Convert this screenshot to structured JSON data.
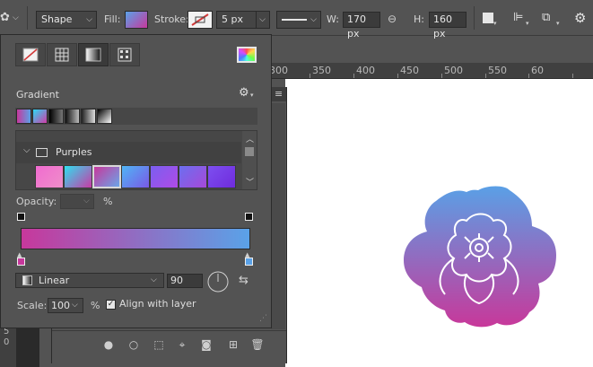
{
  "options_bar": {
    "shape_mode": "Shape",
    "fill_label": "Fill:",
    "stroke_label": "Stroke:",
    "stroke_width": "5 px",
    "w_label": "W:",
    "width_value": "170 px",
    "h_label": "H:",
    "height_value": "160 px"
  },
  "ruler": {
    "ticks": [
      "300",
      "350",
      "400",
      "450",
      "500",
      "550",
      "60"
    ]
  },
  "left_ruler": {
    "digits": [
      "5",
      "0"
    ]
  },
  "gradient_panel": {
    "section_title": "Gradient",
    "folder_name": "Purples",
    "opacity_label": "Opacity:",
    "opacity_value": "",
    "opacity_unit": "%",
    "style_value": "Linear",
    "angle_value": "90",
    "scale_label": "Scale:",
    "scale_value": "100",
    "scale_unit": "%",
    "align_label": "Align with layer",
    "align_checked": true,
    "gradient_start_color": "#c7389c",
    "gradient_end_color": "#5aa2e8"
  },
  "colors": {
    "flower_top": "#5aa0e6",
    "flower_bottom": "#c8389a",
    "panel_bg": "#535353"
  }
}
